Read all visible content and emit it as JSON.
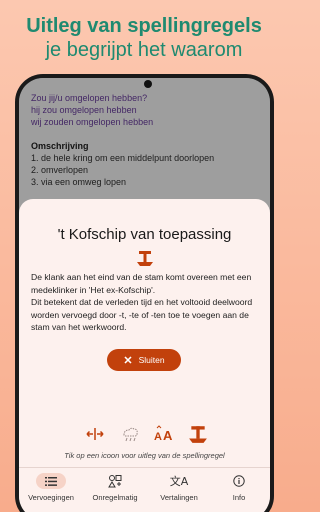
{
  "headline": {
    "line1": "Uitleg van spellingregels",
    "line2": "je begrijpt het waarom"
  },
  "background_content": {
    "conjugations": [
      "Zou jij/u omgelopen hebben?",
      "hij zou omgelopen hebben",
      "wij zouden omgelopen hebben"
    ],
    "description_heading": "Omschrijving",
    "descriptions": [
      "1. de hele kring om een middelpunt doorlopen",
      "2. omverlopen",
      "3. via een omweg lopen"
    ]
  },
  "sheet": {
    "title": "'t Kofschip van toepassing",
    "paragraph1": "De klank aan het eind van de stam komt overeen met een medeklinker in 'Het ex-Kofschip'.",
    "paragraph2": "Dit betekent dat de verleden tijd en het voltooid deelwoord worden vervoegd door -t, -te of -ten toe te voegen aan de stam van het werkwoord.",
    "close_label": "Sluiten",
    "hint": "Tik op een icoon voor uitleg van de spellingregel"
  },
  "icons": [
    "split-arrows-icon",
    "weather-icon",
    "font-size-icon",
    "kofschip-icon"
  ],
  "nav": {
    "items": [
      {
        "label": "Vervoegingen",
        "icon": "list-icon",
        "active": true
      },
      {
        "label": "Onregelmatig",
        "icon": "irregular-icon",
        "active": false
      },
      {
        "label": "Vertalingen",
        "icon": "translate-icon",
        "active": false
      },
      {
        "label": "Info",
        "icon": "info-icon",
        "active": false
      }
    ]
  },
  "colors": {
    "accent": "#c2410c",
    "headline": "#1f8a70",
    "sheet_bg": "#fdf1ee"
  }
}
